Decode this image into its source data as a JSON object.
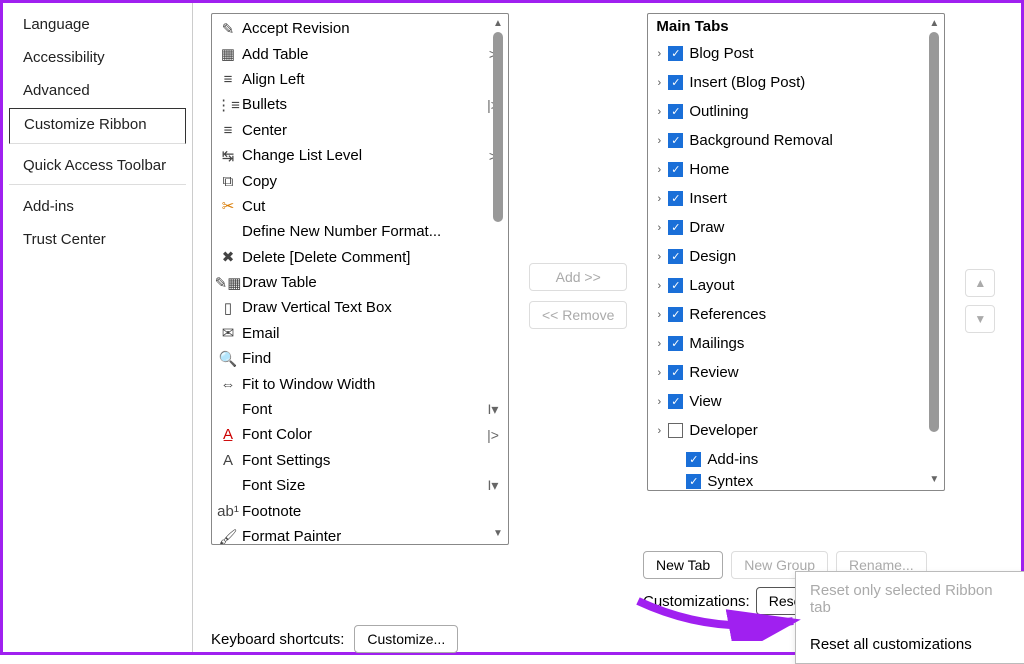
{
  "sidebar": {
    "items": [
      {
        "label": "Language"
      },
      {
        "label": "Accessibility"
      },
      {
        "label": "Advanced"
      },
      {
        "label": "Customize Ribbon",
        "selected": true,
        "divider": true
      },
      {
        "label": "Quick Access Toolbar",
        "divider": true
      },
      {
        "label": "Add-ins"
      },
      {
        "label": "Trust Center"
      }
    ]
  },
  "commands": [
    {
      "icon": "accept-revision-icon",
      "glyph": "✎",
      "label": "Accept Revision"
    },
    {
      "icon": "table-icon",
      "glyph": "▦",
      "label": "Add Table",
      "arrow": ">"
    },
    {
      "icon": "align-left-icon",
      "glyph": "≡",
      "label": "Align Left"
    },
    {
      "icon": "bullets-icon",
      "glyph": "⋮≡",
      "label": "Bullets",
      "arrow": "|>"
    },
    {
      "icon": "center-icon",
      "glyph": "≡",
      "label": "Center"
    },
    {
      "icon": "list-level-icon",
      "glyph": "↹",
      "label": "Change List Level",
      "arrow": ">"
    },
    {
      "icon": "copy-icon",
      "glyph": "⧉",
      "label": "Copy"
    },
    {
      "icon": "cut-icon",
      "glyph": "✂",
      "label": "Cut"
    },
    {
      "icon": "",
      "glyph": "",
      "label": "Define New Number Format..."
    },
    {
      "icon": "delete-comment-icon",
      "glyph": "✖",
      "label": "Delete [Delete Comment]"
    },
    {
      "icon": "draw-table-icon",
      "glyph": "✎▦",
      "label": "Draw Table"
    },
    {
      "icon": "vertical-textbox-icon",
      "glyph": "▯",
      "label": "Draw Vertical Text Box"
    },
    {
      "icon": "email-icon",
      "glyph": "✉",
      "label": "Email"
    },
    {
      "icon": "find-icon",
      "glyph": "🔍",
      "label": "Find"
    },
    {
      "icon": "fit-width-icon",
      "glyph": "⇔",
      "label": "Fit to Window Width"
    },
    {
      "icon": "",
      "glyph": "",
      "label": "Font",
      "arrow": "I▾"
    },
    {
      "icon": "font-color-icon",
      "glyph": "A̲",
      "label": "Font Color",
      "arrow": "|>"
    },
    {
      "icon": "font-settings-icon",
      "glyph": "A",
      "label": "Font Settings"
    },
    {
      "icon": "",
      "glyph": "",
      "label": "Font Size",
      "arrow": "I▾"
    },
    {
      "icon": "footnote-icon",
      "glyph": "ab¹",
      "label": "Footnote"
    },
    {
      "icon": "format-painter-icon",
      "glyph": "🖌",
      "label": "Format Painter"
    }
  ],
  "mid_buttons": {
    "add": "Add >>",
    "remove": "<< Remove"
  },
  "main_tabs_header": "Main Tabs",
  "main_tabs": [
    {
      "label": "Blog Post",
      "checked": true,
      "expand": true
    },
    {
      "label": "Insert (Blog Post)",
      "checked": true,
      "expand": true
    },
    {
      "label": "Outlining",
      "checked": true,
      "expand": true
    },
    {
      "label": "Background Removal",
      "checked": true,
      "expand": true
    },
    {
      "label": "Home",
      "checked": true,
      "expand": true
    },
    {
      "label": "Insert",
      "checked": true,
      "expand": true
    },
    {
      "label": "Draw",
      "checked": true,
      "expand": true
    },
    {
      "label": "Design",
      "checked": true,
      "expand": true
    },
    {
      "label": "Layout",
      "checked": true,
      "expand": true
    },
    {
      "label": "References",
      "checked": true,
      "expand": true
    },
    {
      "label": "Mailings",
      "checked": true,
      "expand": true
    },
    {
      "label": "Review",
      "checked": true,
      "expand": true
    },
    {
      "label": "View",
      "checked": true,
      "expand": true
    },
    {
      "label": "Developer",
      "checked": false,
      "expand": true
    },
    {
      "label": "Add-ins",
      "checked": true,
      "expand": false,
      "indent": true
    },
    {
      "label": "Syntex",
      "checked": true,
      "expand": false,
      "indent": true,
      "cut": true
    }
  ],
  "tab_buttons": {
    "new_tab": "New Tab",
    "new_group": "New Group",
    "rename": "Rename..."
  },
  "customizations_label": "Customizations:",
  "reset_button": "Reset",
  "reset_menu": {
    "item1": "Reset only selected Ribbon tab",
    "item2": "Reset all customizations"
  },
  "keyboard": {
    "label": "Keyboard shortcuts:",
    "button": "Customize..."
  }
}
